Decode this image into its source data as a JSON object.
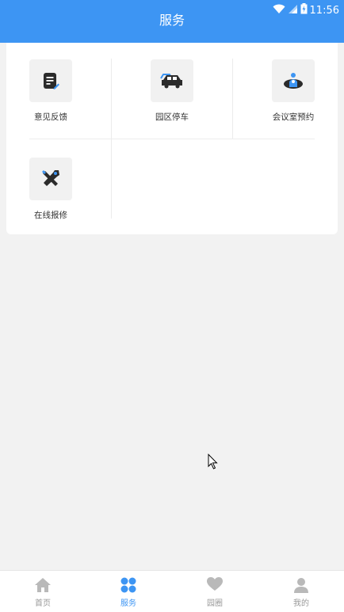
{
  "status_bar": {
    "time": "11:56"
  },
  "header": {
    "title": "服务"
  },
  "services": [
    {
      "label": "意见反馈",
      "icon": "feedback-icon"
    },
    {
      "label": "园区停车",
      "icon": "parking-car-icon"
    },
    {
      "label": "会议室预约",
      "icon": "meeting-room-icon"
    },
    {
      "label": "在线报修",
      "icon": "repair-tools-icon"
    }
  ],
  "tabs": [
    {
      "label": "首页",
      "icon": "home-icon",
      "active": false
    },
    {
      "label": "服务",
      "icon": "grid-services-icon",
      "active": true
    },
    {
      "label": "园圈",
      "icon": "heart-icon",
      "active": false
    },
    {
      "label": "我的",
      "icon": "user-icon",
      "active": false
    }
  ],
  "colors": {
    "brand": "#3d95f3",
    "inactive_tab": "#999999",
    "page_bg": "#f2f2f2"
  }
}
